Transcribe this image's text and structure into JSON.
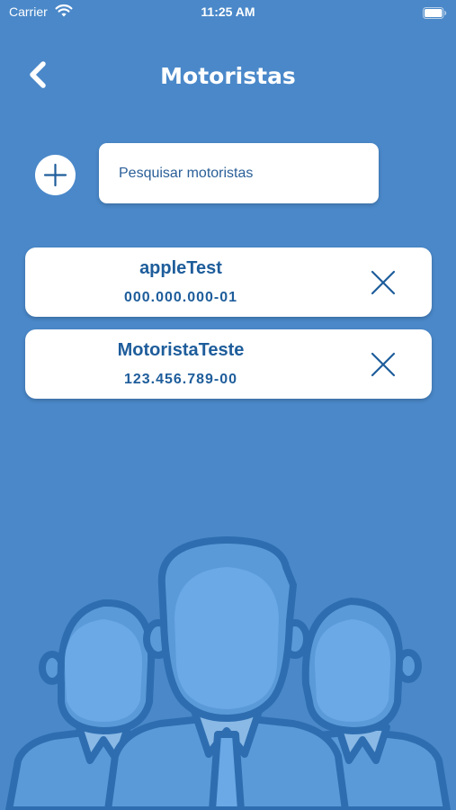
{
  "status_bar": {
    "carrier": "Carrier",
    "time": "11:25 AM"
  },
  "header": {
    "title": "Motoristas"
  },
  "search": {
    "placeholder": "Pesquisar motoristas",
    "value": ""
  },
  "drivers": [
    {
      "name": "appleTest",
      "cpf": "000.000.000-01"
    },
    {
      "name": "MotoristaTeste",
      "cpf": "123.456.789-00"
    }
  ],
  "icons": {
    "back": "chevron-left-icon",
    "add": "plus-icon",
    "remove": "close-icon",
    "wifi": "wifi-icon",
    "battery": "battery-icon"
  },
  "colors": {
    "background": "#4a88c9",
    "accent": "#1e5d9b",
    "card": "#ffffff"
  }
}
